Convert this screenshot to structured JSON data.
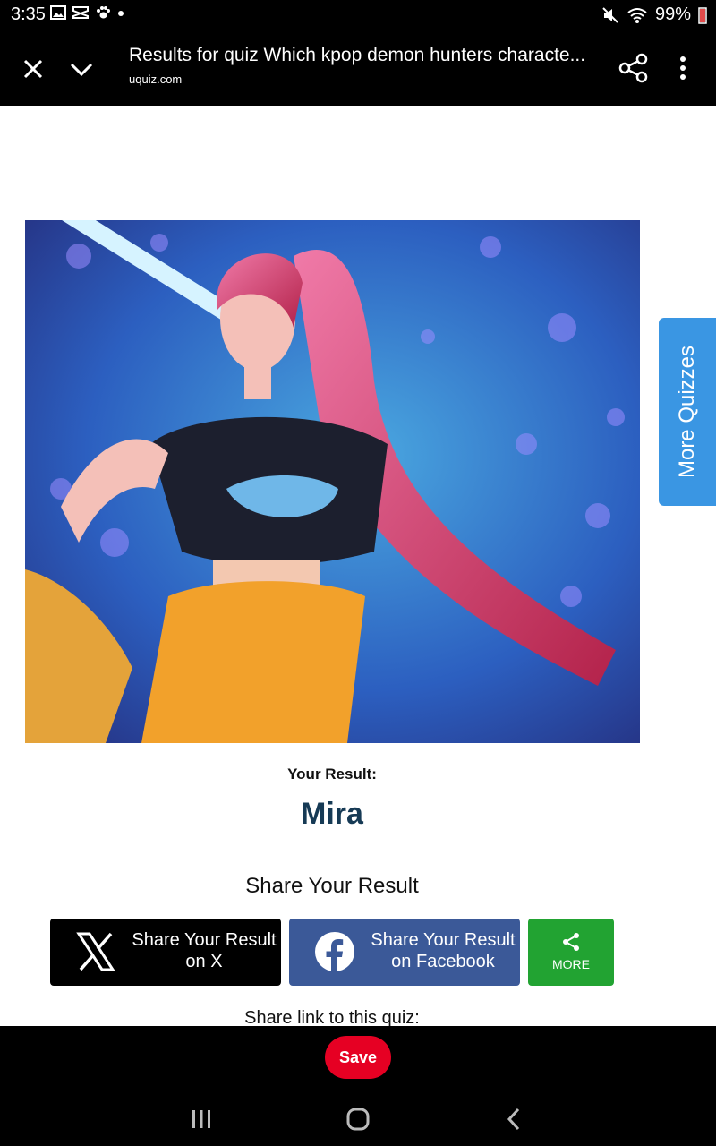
{
  "status_bar": {
    "time": "3:35",
    "battery": "99%"
  },
  "browser": {
    "title": "Results for quiz Which kpop demon hunters characte...",
    "url": "uquiz.com"
  },
  "side_tab": {
    "label": "More Quizzes"
  },
  "result": {
    "label": "Your Result:",
    "name": "Mira"
  },
  "share": {
    "heading": "Share Your Result",
    "x_line1": "Share Your Result",
    "x_line2": "on X",
    "facebook_line1": "Share Your Result",
    "facebook_line2": "on Facebook",
    "more_label": "MORE",
    "link_label": "Share link to this quiz:"
  },
  "bottom": {
    "save_label": "Save"
  },
  "colors": {
    "facebook": "#3b5998",
    "more_green": "#22a332",
    "side_tab_blue": "#3a96e3",
    "save_red": "#e60023",
    "result_name": "#163a55"
  },
  "icons": {
    "close": "close-icon",
    "chevron": "chevron-down-icon",
    "share": "share-icon",
    "more": "more-vertical-icon",
    "x_logo": "x-logo-icon",
    "facebook_logo": "facebook-logo-icon",
    "share_more": "share-icon",
    "nav_recents": "recents-icon",
    "nav_home": "home-icon",
    "nav_back": "back-icon"
  }
}
